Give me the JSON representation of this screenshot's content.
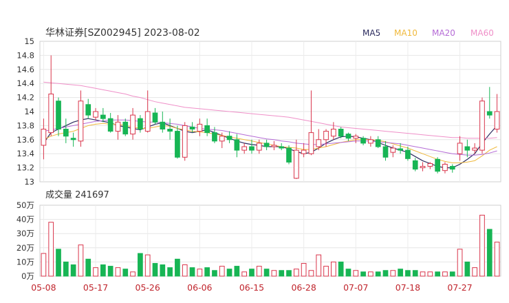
{
  "title": "华林证券[SZ002945] 2023-08-02",
  "legend": [
    {
      "label": "MA5",
      "color": "#2b2b5e"
    },
    {
      "label": "MA10",
      "color": "#f0b93c"
    },
    {
      "label": "MA20",
      "color": "#b56bd6"
    },
    {
      "label": "MA60",
      "color": "#ef8fc8"
    }
  ],
  "volume_title": "成交量 241697",
  "colors": {
    "up": "#d9344a",
    "down": "#17b554",
    "grid": "#e6e6e6",
    "xlabel": "#c0242c"
  },
  "chart_data": [
    {
      "type": "candlestick",
      "ylim": [
        13,
        15
      ],
      "yticks": [
        "15",
        "14.8",
        "14.6",
        "14.4",
        "14.2",
        "14",
        "13.8",
        "13.6",
        "13.4",
        "13.2",
        "13"
      ],
      "xtick_labels": [
        {
          "label": "05-08",
          "index": 0
        },
        {
          "label": "05-17",
          "index": 7
        },
        {
          "label": "05-26",
          "index": 14
        },
        {
          "label": "06-06",
          "index": 21
        },
        {
          "label": "06-15",
          "index": 28
        },
        {
          "label": "06-28",
          "index": 35
        },
        {
          "label": "07-07",
          "index": 42
        },
        {
          "label": "07-18",
          "index": 49
        },
        {
          "label": "07-27",
          "index": 56
        }
      ],
      "candles": [
        {
          "o": 13.52,
          "h": 13.9,
          "l": 13.32,
          "c": 13.75
        },
        {
          "o": 13.7,
          "h": 14.8,
          "l": 13.65,
          "c": 14.25
        },
        {
          "o": 14.15,
          "h": 14.2,
          "l": 13.65,
          "c": 13.75
        },
        {
          "o": 13.75,
          "h": 13.9,
          "l": 13.55,
          "c": 13.65
        },
        {
          "o": 13.62,
          "h": 13.7,
          "l": 13.5,
          "c": 13.6
        },
        {
          "o": 13.58,
          "h": 14.3,
          "l": 13.5,
          "c": 14.15
        },
        {
          "o": 14.1,
          "h": 14.18,
          "l": 13.9,
          "c": 13.95
        },
        {
          "o": 13.92,
          "h": 14.05,
          "l": 13.88,
          "c": 14.0
        },
        {
          "o": 13.95,
          "h": 14.05,
          "l": 13.85,
          "c": 13.9
        },
        {
          "o": 13.9,
          "h": 13.98,
          "l": 13.7,
          "c": 13.72
        },
        {
          "o": 13.72,
          "h": 13.95,
          "l": 13.6,
          "c": 13.85
        },
        {
          "o": 13.85,
          "h": 13.9,
          "l": 13.65,
          "c": 13.68
        },
        {
          "o": 13.68,
          "h": 14.05,
          "l": 13.6,
          "c": 13.95
        },
        {
          "o": 13.9,
          "h": 13.95,
          "l": 13.7,
          "c": 13.75
        },
        {
          "o": 13.72,
          "h": 14.3,
          "l": 13.7,
          "c": 14.0
        },
        {
          "o": 13.98,
          "h": 14.05,
          "l": 13.82,
          "c": 13.85
        },
        {
          "o": 13.85,
          "h": 14.0,
          "l": 13.7,
          "c": 13.75
        },
        {
          "o": 13.75,
          "h": 13.9,
          "l": 13.6,
          "c": 13.72
        },
        {
          "o": 13.72,
          "h": 13.8,
          "l": 13.33,
          "c": 13.35
        },
        {
          "o": 13.35,
          "h": 13.85,
          "l": 13.3,
          "c": 13.8
        },
        {
          "o": 13.78,
          "h": 13.85,
          "l": 13.7,
          "c": 13.75
        },
        {
          "o": 13.72,
          "h": 13.9,
          "l": 13.65,
          "c": 13.82
        },
        {
          "o": 13.8,
          "h": 13.9,
          "l": 13.65,
          "c": 13.7
        },
        {
          "o": 13.7,
          "h": 13.78,
          "l": 13.55,
          "c": 13.58
        },
        {
          "o": 13.58,
          "h": 13.7,
          "l": 13.48,
          "c": 13.65
        },
        {
          "o": 13.65,
          "h": 13.72,
          "l": 13.55,
          "c": 13.6
        },
        {
          "o": 13.6,
          "h": 13.68,
          "l": 13.35,
          "c": 13.45
        },
        {
          "o": 13.45,
          "h": 13.55,
          "l": 13.4,
          "c": 13.5
        },
        {
          "o": 13.5,
          "h": 13.6,
          "l": 13.4,
          "c": 13.45
        },
        {
          "o": 13.45,
          "h": 13.6,
          "l": 13.4,
          "c": 13.55
        },
        {
          "o": 13.55,
          "h": 13.6,
          "l": 13.45,
          "c": 13.5
        },
        {
          "o": 13.5,
          "h": 13.58,
          "l": 13.45,
          "c": 13.52
        },
        {
          "o": 13.5,
          "h": 13.55,
          "l": 13.45,
          "c": 13.48
        },
        {
          "o": 13.48,
          "h": 13.52,
          "l": 13.25,
          "c": 13.28
        },
        {
          "o": 13.05,
          "h": 13.6,
          "l": 13.04,
          "c": 13.45
        },
        {
          "o": 13.4,
          "h": 13.55,
          "l": 13.35,
          "c": 13.45
        },
        {
          "o": 13.4,
          "h": 14.3,
          "l": 13.38,
          "c": 13.7
        },
        {
          "o": 13.5,
          "h": 13.75,
          "l": 13.45,
          "c": 13.6
        },
        {
          "o": 13.6,
          "h": 13.75,
          "l": 13.5,
          "c": 13.72
        },
        {
          "o": 13.65,
          "h": 13.85,
          "l": 13.6,
          "c": 13.75
        },
        {
          "o": 13.75,
          "h": 13.78,
          "l": 13.62,
          "c": 13.65
        },
        {
          "o": 13.68,
          "h": 13.7,
          "l": 13.58,
          "c": 13.62
        },
        {
          "o": 13.62,
          "h": 13.68,
          "l": 13.55,
          "c": 13.65
        },
        {
          "o": 13.62,
          "h": 13.65,
          "l": 13.52,
          "c": 13.55
        },
        {
          "o": 13.55,
          "h": 13.65,
          "l": 13.5,
          "c": 13.6
        },
        {
          "o": 13.6,
          "h": 13.65,
          "l": 13.48,
          "c": 13.5
        },
        {
          "o": 13.5,
          "h": 13.58,
          "l": 13.3,
          "c": 13.35
        },
        {
          "o": 13.42,
          "h": 13.52,
          "l": 13.35,
          "c": 13.48
        },
        {
          "o": 13.47,
          "h": 13.55,
          "l": 13.4,
          "c": 13.45
        },
        {
          "o": 13.45,
          "h": 13.5,
          "l": 13.3,
          "c": 13.33
        },
        {
          "o": 13.3,
          "h": 13.34,
          "l": 13.15,
          "c": 13.18
        },
        {
          "o": 13.2,
          "h": 13.28,
          "l": 13.15,
          "c": 13.22
        },
        {
          "o": 13.22,
          "h": 13.28,
          "l": 13.18,
          "c": 13.26
        },
        {
          "o": 13.32,
          "h": 13.35,
          "l": 13.12,
          "c": 13.15
        },
        {
          "o": 13.16,
          "h": 13.28,
          "l": 13.12,
          "c": 13.25
        },
        {
          "o": 13.22,
          "h": 13.25,
          "l": 13.13,
          "c": 13.18
        },
        {
          "o": 13.4,
          "h": 13.65,
          "l": 13.3,
          "c": 13.55
        },
        {
          "o": 13.5,
          "h": 13.6,
          "l": 13.35,
          "c": 13.45
        },
        {
          "o": 13.45,
          "h": 13.55,
          "l": 13.4,
          "c": 13.48
        },
        {
          "o": 13.45,
          "h": 14.2,
          "l": 13.4,
          "c": 14.15
        },
        {
          "o": 14.0,
          "h": 14.35,
          "l": 13.9,
          "c": 13.95
        },
        {
          "o": 13.75,
          "h": 14.25,
          "l": 13.7,
          "c": 14.0
        }
      ],
      "ma_series": [
        {
          "name": "MA5",
          "values": [
            13.55,
            13.7,
            13.75,
            13.8,
            13.85,
            13.88,
            13.9,
            13.88,
            13.86,
            13.84,
            13.8,
            13.78,
            13.76,
            13.74,
            13.78,
            13.82,
            13.84,
            13.8,
            13.76,
            13.72,
            13.7,
            13.72,
            13.74,
            13.7,
            13.66,
            13.62,
            13.58,
            13.55,
            13.53,
            13.52,
            13.5,
            13.5,
            13.5,
            13.47,
            13.43,
            13.4,
            13.42,
            13.48,
            13.55,
            13.6,
            13.64,
            13.65,
            13.64,
            13.62,
            13.6,
            13.56,
            13.52,
            13.48,
            13.45,
            13.42,
            13.36,
            13.3,
            13.26,
            13.22,
            13.2,
            13.2,
            13.25,
            13.32,
            13.4,
            13.55,
            13.68,
            13.8
          ]
        },
        {
          "name": "MA10",
          "values": [
            13.6,
            13.65,
            13.68,
            13.7,
            13.72,
            13.76,
            13.8,
            13.82,
            13.83,
            13.82,
            13.82,
            13.8,
            13.78,
            13.76,
            13.76,
            13.78,
            13.8,
            13.79,
            13.76,
            13.74,
            13.72,
            13.71,
            13.7,
            13.68,
            13.66,
            13.64,
            13.62,
            13.6,
            13.58,
            13.56,
            13.54,
            13.52,
            13.5,
            13.49,
            13.48,
            13.46,
            13.46,
            13.48,
            13.5,
            13.53,
            13.56,
            13.58,
            13.6,
            13.6,
            13.6,
            13.59,
            13.57,
            13.54,
            13.51,
            13.48,
            13.44,
            13.4,
            13.36,
            13.32,
            13.29,
            13.27,
            13.27,
            13.28,
            13.3,
            13.37,
            13.45,
            13.5
          ]
        },
        {
          "name": "MA20",
          "values": [
            13.72,
            13.74,
            13.76,
            13.78,
            13.8,
            13.82,
            13.84,
            13.86,
            13.87,
            13.88,
            13.88,
            13.88,
            13.87,
            13.86,
            13.85,
            13.85,
            13.84,
            13.83,
            13.82,
            13.8,
            13.78,
            13.76,
            13.75,
            13.74,
            13.73,
            13.71,
            13.69,
            13.67,
            13.65,
            13.63,
            13.61,
            13.6,
            13.58,
            13.57,
            13.55,
            13.54,
            13.53,
            13.53,
            13.54,
            13.55,
            13.56,
            13.57,
            13.58,
            13.58,
            13.58,
            13.57,
            13.56,
            13.55,
            13.54,
            13.52,
            13.5,
            13.48,
            13.46,
            13.44,
            13.42,
            13.4,
            13.39,
            13.38,
            13.38,
            13.39,
            13.41,
            13.44
          ]
        },
        {
          "name": "MA60",
          "values": [
            14.42,
            14.41,
            14.4,
            14.39,
            14.38,
            14.37,
            14.35,
            14.33,
            14.31,
            14.29,
            14.27,
            14.25,
            14.22,
            14.2,
            14.17,
            14.14,
            14.12,
            14.1,
            14.08,
            14.06,
            14.05,
            14.04,
            14.03,
            14.02,
            14.01,
            14.0,
            13.99,
            13.98,
            13.97,
            13.96,
            13.95,
            13.94,
            13.93,
            13.92,
            13.9,
            13.88,
            13.86,
            13.84,
            13.82,
            13.8,
            13.78,
            13.77,
            13.76,
            13.75,
            13.74,
            13.73,
            13.72,
            13.71,
            13.7,
            13.69,
            13.68,
            13.67,
            13.66,
            13.65,
            13.64,
            13.63,
            13.63,
            13.62,
            13.62,
            13.62,
            13.62,
            13.63
          ]
        }
      ]
    },
    {
      "type": "bar",
      "ylim": [
        0,
        50
      ],
      "yticks": [
        "50万",
        "40万",
        "30万",
        "20万",
        "10万",
        "0万"
      ],
      "volumes": [
        16,
        38,
        19,
        10,
        8,
        22,
        12,
        6,
        8,
        7,
        6,
        5,
        3,
        16,
        15,
        9,
        8,
        6,
        12,
        8,
        6,
        5,
        6,
        4,
        7,
        5,
        7,
        3,
        5,
        7,
        5,
        4,
        4,
        4,
        5,
        9,
        4,
        15,
        7,
        10,
        10,
        5,
        4,
        3,
        3,
        3,
        4,
        4,
        5,
        4,
        4,
        3,
        3,
        3,
        3,
        3,
        19,
        10,
        6,
        43,
        33,
        24
      ]
    }
  ]
}
